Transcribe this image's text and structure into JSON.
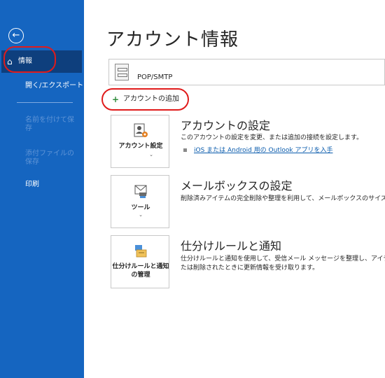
{
  "sidebar": {
    "back_icon": "back-arrow-icon",
    "items": [
      {
        "label": "情報",
        "icon": "home-icon",
        "active": true
      },
      {
        "label": "開く/エクスポート"
      },
      {
        "label": "名前を付けて保存",
        "disabled": true
      },
      {
        "label": "添付ファイルの保存",
        "disabled": true
      },
      {
        "label": "印刷"
      }
    ],
    "colors": {
      "background": "#1565c0",
      "active": "#0e3f7d",
      "highlight_ring": "#e01b1b"
    }
  },
  "main": {
    "title": "アカウント情報",
    "account": {
      "label": "POP/SMTP"
    },
    "add_account": {
      "label": "アカウントの追加"
    },
    "sections": [
      {
        "tile_label": "アカウント設定",
        "title": "アカウントの設定",
        "description": "このアカウントの設定を変更、または追加の接続を設定します。",
        "link": "iOS または Android 用の Outlook アプリを入手"
      },
      {
        "tile_label": "ツール",
        "title": "メールボックスの設定",
        "description": "削除済みアイテムの完全削除や整理を利用して、メールボックスのサイズを"
      },
      {
        "tile_label": "仕分けルールと通知の管理",
        "title": "仕分けルールと通知",
        "description_line1": "仕分けルールと通知を使用して、受信メール メッセージを整理し、アイテム",
        "description_line2": "たは削除されたときに更新情報を受け取ります。"
      }
    ]
  }
}
